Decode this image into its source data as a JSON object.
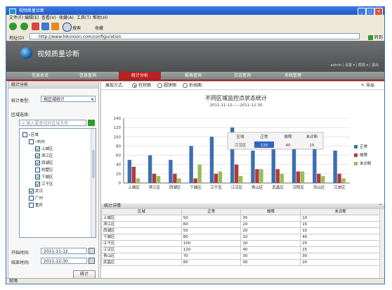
{
  "window": {
    "title": "视频质量诊断"
  },
  "menu": [
    "文件(F)",
    "编辑(E)",
    "查看(V)",
    "收藏(A)",
    "工具(T)",
    "帮助(H)"
  ],
  "toolbar": {
    "search": "搜索",
    "favorites": "收藏"
  },
  "address": {
    "label": "地址(D)",
    "url": "http://www.hikvision.com/configuration",
    "go": "转到"
  },
  "app": {
    "title": "视频质量诊断",
    "header_right": "admin | 设置 ▾ | 帮助 ▾ | 退出"
  },
  "nav": [
    "信息总览",
    "信息查询",
    "统计分析",
    "报表查询",
    "日志查询",
    "系统管理"
  ],
  "nav_active": 2,
  "left": {
    "section": "统计分析",
    "stat_type_label": "统计类型:",
    "stat_type_value": "按区域统计",
    "region_label": "区域选择:",
    "search_placeholder": "输入要查找的区域名称",
    "tree": [
      {
        "text": "区域",
        "level": 0,
        "checked": false,
        "kind": "folder"
      },
      {
        "text": "杭州",
        "level": 1,
        "checked": false,
        "kind": "folder"
      },
      {
        "text": "上城区",
        "level": 2,
        "checked": true
      },
      {
        "text": "滨江区",
        "level": 2,
        "checked": true
      },
      {
        "text": "西湖区",
        "level": 2,
        "checked": true
      },
      {
        "text": "拱墅区",
        "level": 2,
        "checked": false
      },
      {
        "text": "下城区",
        "level": 2,
        "checked": true
      },
      {
        "text": "江干区",
        "level": 2,
        "checked": true
      },
      {
        "text": "武汉",
        "level": 1,
        "checked": true
      },
      {
        "text": "广州",
        "level": 1,
        "checked": false
      },
      {
        "text": "重庆",
        "level": 1,
        "checked": false
      }
    ],
    "start_label": "开始时间:",
    "start_value": "2011-11-12",
    "end_label": "结束时间:",
    "end_value": "2011-12-30",
    "stat_button": "统计"
  },
  "right": {
    "display_label": "展现方式:",
    "options": [
      "柱状图",
      "圆饼图",
      "折线图"
    ],
    "selected_option": 0,
    "export": "导出",
    "detail_title": "统计详情"
  },
  "chart_data": {
    "type": "bar",
    "title": "不同区域监控点状态统计",
    "subtitle": "2011-11-12——2011-12-30",
    "categories": [
      "上城区",
      "滨江区",
      "西湖区",
      "下城区",
      "江干区",
      "江汉区",
      "青山区",
      "武昌区",
      "汉阳区",
      "洪山区",
      "江岸区"
    ],
    "series": [
      {
        "name": "正常",
        "color": "#3d6fb0",
        "values": [
          50,
          60,
          50,
          80,
          100,
          120,
          70,
          80,
          100,
          90,
          70
        ]
      },
      {
        "name": "故障",
        "color": "#b33a3a",
        "values": [
          35,
          20,
          20,
          10,
          20,
          40,
          30,
          30,
          25,
          20,
          20
        ]
      },
      {
        "name": "未诊断",
        "color": "#9bbb59",
        "values": [
          10,
          15,
          10,
          40,
          25,
          15,
          30,
          20,
          25,
          15,
          10
        ]
      }
    ],
    "ylim": [
      0,
      140
    ],
    "yticks": [
      0,
      20,
      40,
      60,
      80,
      100,
      120,
      140
    ],
    "legend": "right",
    "tooltip": {
      "headers": [
        "区域",
        "正常",
        "故障",
        "未诊断"
      ],
      "row": [
        "江汉区",
        "120",
        "40",
        "15"
      ]
    }
  },
  "table": {
    "headers": [
      "区域",
      "正常",
      "故障",
      "未诊断"
    ],
    "rows": [
      [
        "上城区",
        "50",
        "35",
        "10"
      ],
      [
        "滨江区",
        "60",
        "20",
        "15"
      ],
      [
        "西湖区",
        "50",
        "20",
        "10"
      ],
      [
        "下城区",
        "80",
        "10",
        "40"
      ],
      [
        "江干区",
        "100",
        "20",
        "25"
      ],
      [
        "江汉区",
        "120",
        "40",
        "15"
      ],
      [
        "青山区",
        "70",
        "30",
        "30"
      ],
      [
        "武昌区",
        "80",
        "30",
        "20"
      ]
    ]
  },
  "status": {
    "text": "就绪"
  }
}
